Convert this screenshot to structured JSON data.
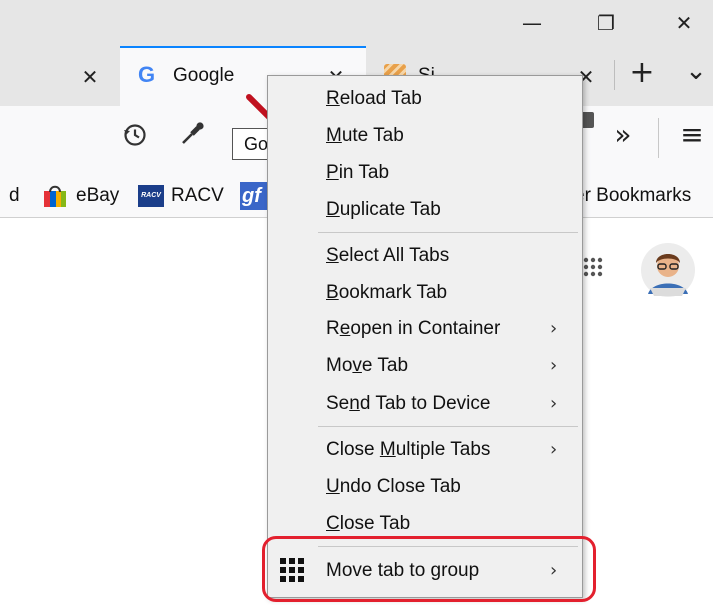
{
  "window": {
    "minimize": "—",
    "maximize": "❐",
    "close": "✕"
  },
  "tabs": {
    "close_left": "✕",
    "active": {
      "title": "Google",
      "favicon_letter": "G",
      "close": "✕"
    },
    "next": {
      "title_fragment": "Si",
      "close": "✕"
    },
    "new_tab": "+",
    "list_all": "⌄"
  },
  "toolbar": {
    "overflow": "»",
    "menu": "≡"
  },
  "tooltip": "Google",
  "bookmarks": {
    "left_fragment": "d",
    "items": [
      "eBay",
      "RACV"
    ],
    "racv_badge": "RACV",
    "gf_badge": "gf",
    "other_fragment": "er Bookmarks"
  },
  "context_menu": {
    "items": [
      {
        "pre": "",
        "key": "R",
        "post": "eload Tab",
        "submenu": false
      },
      {
        "pre": "",
        "key": "M",
        "post": "ute Tab",
        "submenu": false
      },
      {
        "pre": "",
        "key": "P",
        "post": "in Tab",
        "submenu": false
      },
      {
        "pre": "",
        "key": "D",
        "post": "uplicate Tab",
        "submenu": false
      },
      {
        "pre": "",
        "key": "S",
        "post": "elect All Tabs",
        "submenu": false
      },
      {
        "pre": "",
        "key": "B",
        "post": "ookmark Tab",
        "submenu": false
      },
      {
        "pre": "R",
        "key": "e",
        "post": "open in Container",
        "submenu": true
      },
      {
        "pre": "Mo",
        "key": "v",
        "post": "e Tab",
        "submenu": true
      },
      {
        "pre": "Se",
        "key": "n",
        "post": "d Tab to Device",
        "submenu": true
      },
      {
        "pre": "Close ",
        "key": "M",
        "post": "ultiple Tabs",
        "submenu": true
      },
      {
        "pre": "",
        "key": "U",
        "post": "ndo Close Tab",
        "submenu": false
      },
      {
        "pre": "",
        "key": "C",
        "post": "lose Tab",
        "submenu": false
      },
      {
        "pre": "Move tab to group",
        "key": "",
        "post": "",
        "submenu": true
      }
    ],
    "chevron": "›"
  },
  "colors": {
    "accent": "#0a84ff",
    "highlight": "#e3202e",
    "menu_bg": "#f0f0f0"
  }
}
